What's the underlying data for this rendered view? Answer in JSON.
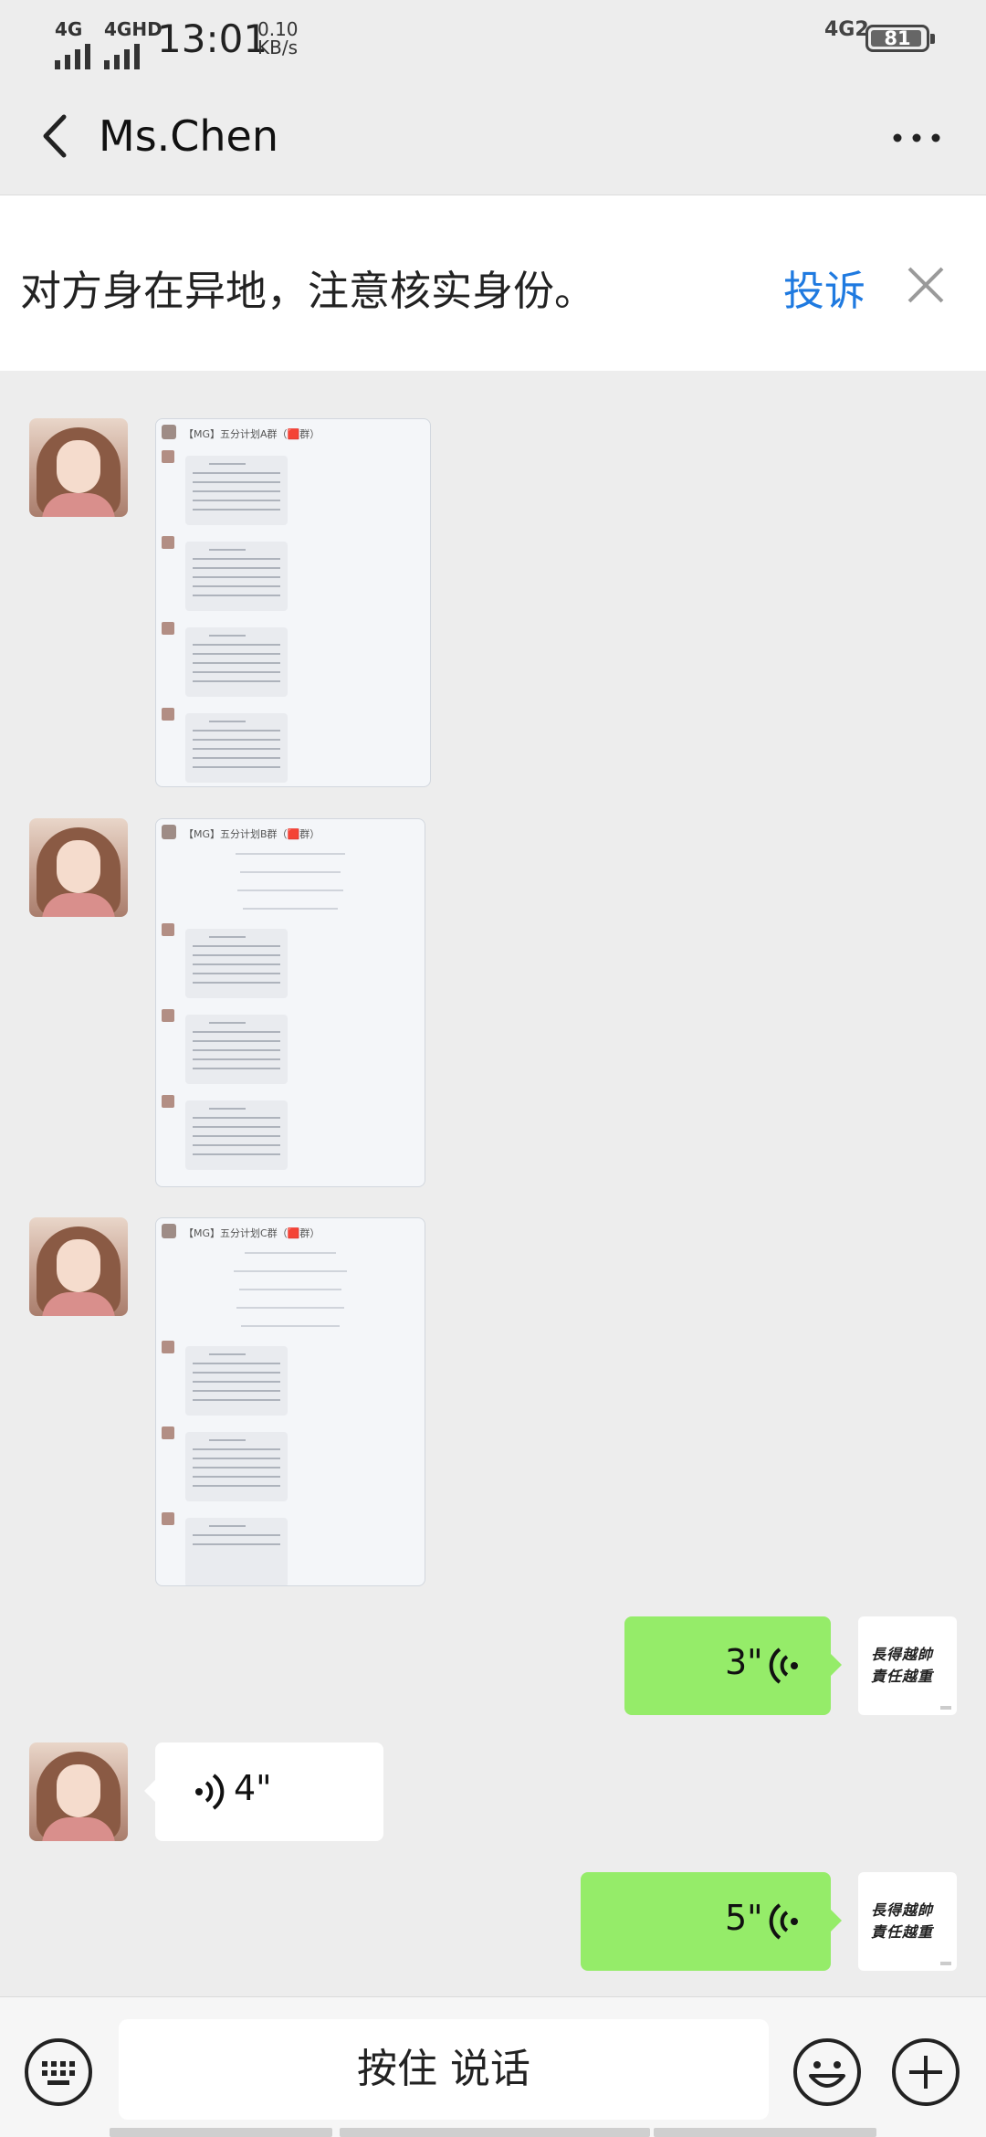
{
  "status_bar": {
    "signal1": "4G",
    "signal2": "4GHD",
    "time": "13:01",
    "speed_value": "0.10",
    "speed_unit": "KB/s",
    "network": "4G2",
    "battery": "81"
  },
  "header": {
    "title": "Ms.Chen",
    "back_icon": "chevron-left-icon",
    "more_icon": "more-dots-icon"
  },
  "warning": {
    "text": "对方身在异地，注意核实身份。",
    "report_label": "投诉",
    "close_icon": "close-icon"
  },
  "messages": [
    {
      "type": "image",
      "from": "contact",
      "header": "【MG】五分计划A群（🟥群）"
    },
    {
      "type": "image",
      "from": "contact",
      "header": "【MG】五分计划B群（🟥群）"
    },
    {
      "type": "image",
      "from": "contact",
      "header": "【MG】五分计划C群（🟥群）"
    },
    {
      "type": "voice",
      "from": "me",
      "duration": "3\""
    },
    {
      "type": "voice",
      "from": "contact",
      "duration": "4\""
    },
    {
      "type": "voice",
      "from": "me",
      "duration": "5\""
    }
  ],
  "my_avatar_text": "長得越帥\n責任越重",
  "input_bar": {
    "keyboard_icon": "keyboard-icon",
    "hold_to_talk_label": "按住 说话",
    "emoji_icon": "emoji-icon",
    "plus_icon": "plus-icon"
  },
  "colors": {
    "background": "#ededed",
    "outgoing_bubble": "#95ec69",
    "incoming_bubble": "#ffffff",
    "link": "#1f7ae0"
  }
}
